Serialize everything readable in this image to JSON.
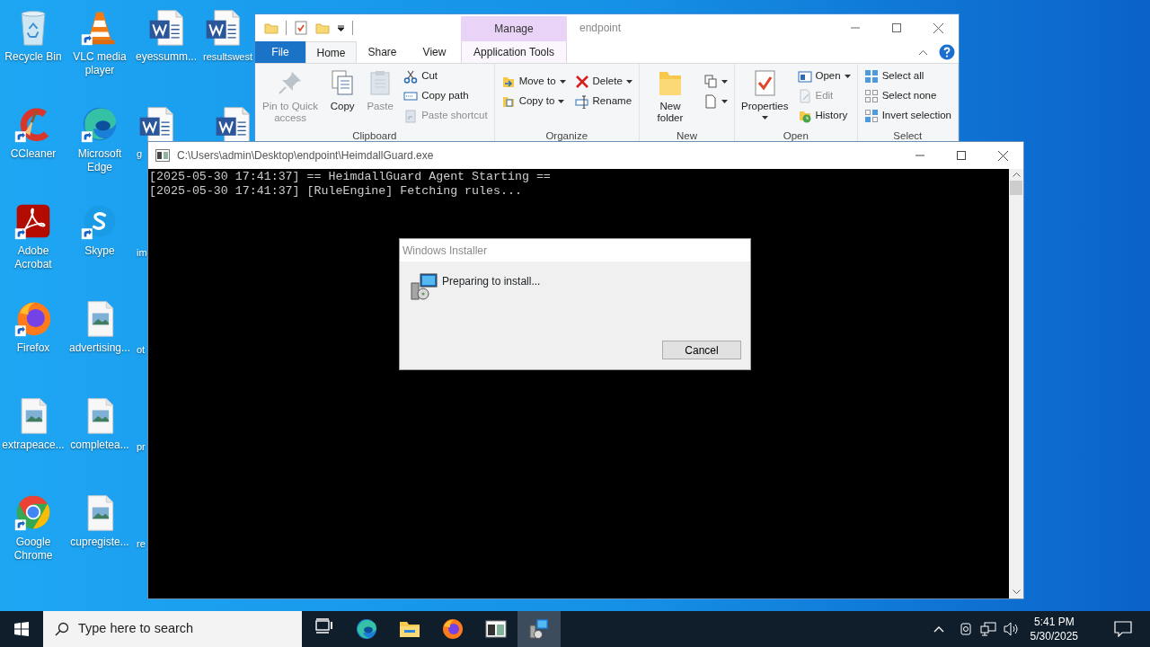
{
  "desktop_icons": [
    {
      "label": "Recycle Bin",
      "kind": "recycle",
      "shortcut": false
    },
    {
      "label": "CCleaner",
      "kind": "cleaner",
      "shortcut": true
    },
    {
      "label": "Adobe Acrobat",
      "kind": "acrobat",
      "shortcut": true
    },
    {
      "label": "Firefox",
      "kind": "firefox",
      "shortcut": true
    },
    {
      "label": "extrapeace...",
      "kind": "image",
      "shortcut": false
    },
    {
      "label": "Google Chrome",
      "kind": "chrome",
      "shortcut": true
    },
    {
      "label": "VLC media player",
      "kind": "cone",
      "shortcut": true
    },
    {
      "label": "Microsoft Edge",
      "kind": "edge",
      "shortcut": true
    },
    {
      "label": "Skype",
      "kind": "skype",
      "shortcut": true
    },
    {
      "label": "advertising...",
      "kind": "image",
      "shortcut": false
    },
    {
      "label": "completea...",
      "kind": "image",
      "shortcut": false
    },
    {
      "label": "cupregiste...",
      "kind": "image",
      "shortcut": false
    },
    {
      "label": "eyessumm...",
      "kind": "document",
      "shortcut": false
    },
    {
      "label": "g",
      "kind": "document",
      "shortcut": false
    },
    {
      "label": "im"
    },
    {
      "label": "ot"
    },
    {
      "label": "pr"
    },
    {
      "label": "re"
    },
    {
      "label": "resultswest",
      "kind": "document",
      "shortcut": false
    },
    {
      "kind": "document",
      "shortcut": false
    }
  ],
  "explorer": {
    "context_tab": "Manage",
    "title": "endpoint",
    "tabs": [
      {
        "label": "File",
        "kind": "file",
        "selected": false
      },
      {
        "label": "Home",
        "kind": "tab",
        "selected": true
      },
      {
        "label": "Share",
        "kind": "tab",
        "selected": false
      },
      {
        "label": "View",
        "kind": "tab",
        "selected": false
      },
      {
        "label": "Application Tools",
        "kind": "context",
        "selected": false
      }
    ],
    "ribbon_groups": [
      {
        "label": "Clipboard",
        "columns": [
          [
            {
              "label": "Pin to Quick access",
              "kind": "pin",
              "large": true,
              "dropdown": false,
              "disabled": true
            }
          ],
          [
            {
              "label": "Copy",
              "kind": "copy",
              "large": true,
              "dropdown": false,
              "disabled": false
            }
          ],
          [
            {
              "label": "Paste",
              "kind": "paste",
              "large": true,
              "dropdown": false,
              "disabled": true
            }
          ],
          [
            {
              "label": "Cut",
              "kind": "cut",
              "large": false,
              "dropdown": false,
              "disabled": false
            },
            {
              "label": "Copy path",
              "kind": "copypath",
              "large": false,
              "dropdown": false,
              "disabled": false
            },
            {
              "label": "Paste shortcut",
              "kind": "pasteshortcut",
              "large": false,
              "dropdown": false,
              "disabled": true
            }
          ]
        ]
      },
      {
        "label": "Organize",
        "columns": [
          [
            {
              "label": "Move to",
              "kind": "moveto",
              "large": false,
              "dropdown": true,
              "disabled": false
            },
            {
              "label": "Copy to",
              "kind": "copyto",
              "large": false,
              "dropdown": true,
              "disabled": false
            }
          ],
          [
            {
              "label": "Delete",
              "kind": "delete",
              "large": false,
              "dropdown": true,
              "disabled": false
            },
            {
              "label": "Rename",
              "kind": "rename",
              "large": false,
              "dropdown": false,
              "disabled": false
            }
          ]
        ]
      },
      {
        "label": "New",
        "columns": [
          [
            {
              "label": "New folder",
              "kind": "newfolder",
              "large": true,
              "dropdown": false,
              "disabled": false
            }
          ],
          [
            {
              "kind": "newitem",
              "large": false,
              "dropdown": true,
              "disabled": false
            },
            {
              "kind": "easyaccess",
              "large": false,
              "dropdown": true,
              "disabled": false
            }
          ]
        ]
      },
      {
        "label": "Open",
        "columns": [
          [
            {
              "label": "Properties",
              "kind": "properties",
              "large": true,
              "dropdown": true,
              "disabled": false
            }
          ],
          [
            {
              "label": "Open",
              "kind": "open",
              "large": false,
              "dropdown": true,
              "disabled": false
            },
            {
              "label": "Edit",
              "kind": "edit",
              "large": false,
              "dropdown": false,
              "disabled": true
            },
            {
              "label": "History",
              "kind": "history",
              "large": false,
              "dropdown": false,
              "disabled": false
            }
          ]
        ]
      },
      {
        "label": "Select",
        "columns": [
          [
            {
              "label": "Select all",
              "kind": "selectall",
              "large": false,
              "dropdown": false,
              "disabled": false
            },
            {
              "label": "Select none",
              "kind": "selectnone",
              "large": false,
              "dropdown": false,
              "disabled": false
            },
            {
              "label": "Invert selection",
              "kind": "invert",
              "large": false,
              "dropdown": false,
              "disabled": false
            }
          ]
        ]
      }
    ]
  },
  "console": {
    "title": "C:\\Users\\admin\\Desktop\\endpoint\\HeimdallGuard.exe",
    "lines": [
      "[2025-05-30 17:41:37] == HeimdallGuard Agent Starting ==",
      "[2025-05-30 17:41:37] [RuleEngine] Fetching rules..."
    ]
  },
  "installer": {
    "title": "Windows Installer",
    "message": "Preparing to install...",
    "buttons": [
      "Cancel"
    ]
  },
  "taskbar": {
    "search_placeholder": "Type here to search",
    "apps": [
      {
        "kind": "taskview",
        "selected": false
      },
      {
        "kind": "edge",
        "selected": false
      },
      {
        "kind": "folder",
        "selected": false
      },
      {
        "kind": "firefox",
        "selected": false
      },
      {
        "kind": "console",
        "selected": false
      },
      {
        "kind": "installer",
        "selected": true
      }
    ],
    "time": "5:41 PM",
    "date": "5/30/2025"
  }
}
